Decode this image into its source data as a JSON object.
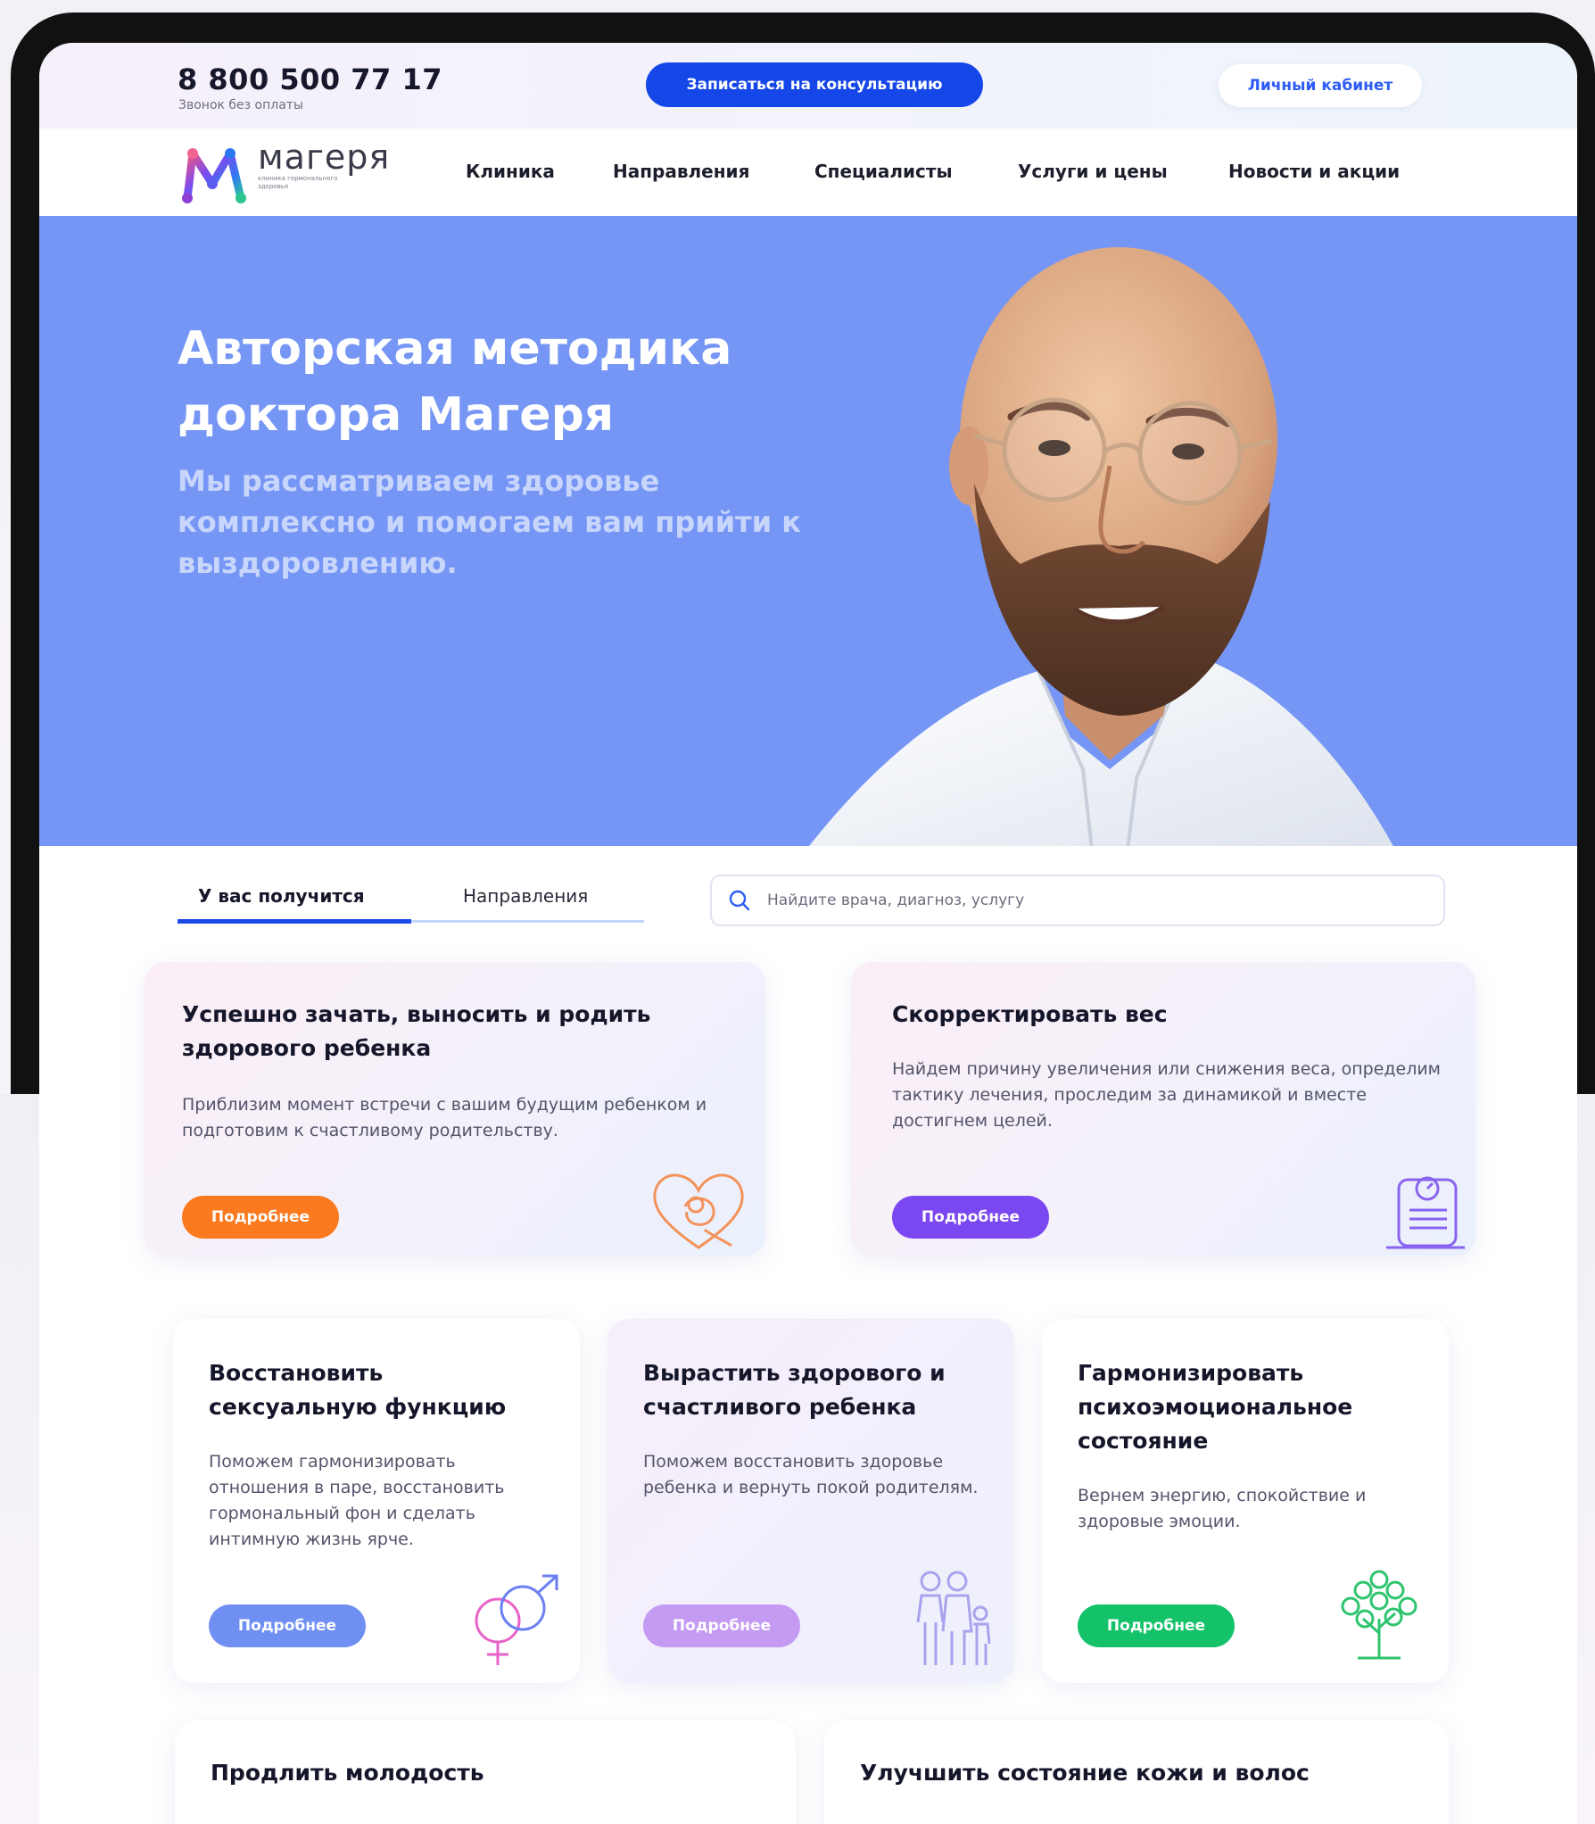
{
  "header": {
    "phone": "8 800 500 77 17",
    "phone_note": "Звонок без оплаты",
    "cta_label": "Записаться на консультацию",
    "cabinet_label": "Личный кабинет"
  },
  "logo": {
    "name": "магеря",
    "tagline": "клиника гормонального здоровья"
  },
  "nav": {
    "items": [
      "Клиника",
      "Направления",
      "Специалисты",
      "Услуги и цены",
      "Новости и акции"
    ]
  },
  "hero": {
    "title_line1": "Авторская методика",
    "title_line2": "доктора Магеря",
    "subtitle": "Мы рассматриваем здоровье комплексно и помогаем вам прийти к выздоровлению."
  },
  "tabs": {
    "active": "У вас получится",
    "inactive": "Направления"
  },
  "search": {
    "placeholder": "Найдите врача, диагноз, услугу"
  },
  "cards": [
    {
      "title": "Успешно зачать, выносить и родить здорового ребенка",
      "text": "Приблизим момент встречи с вашим будущим ребенком и подготовим к счастливому родительству.",
      "button": "Подробнее",
      "icon": "heart-baby-icon",
      "color": "#fb7a1f"
    },
    {
      "title": "Скорректировать вес",
      "text": "Найдем причину увеличения или снижения веса, определим тактику лечения, проследим за динамикой и вместе достигнем целей.",
      "button": "Подробнее",
      "icon": "scale-icon",
      "color": "#7b47f0"
    },
    {
      "title": "Восстановить сексуальную функцию",
      "text": "Поможем гармонизировать отношения в паре, восстановить гормональный фон и сделать интимную жизнь ярче.",
      "button": "Подробнее",
      "icon": "gender-symbols-icon",
      "color": "#6f8ff2"
    },
    {
      "title": "Вырастить здорового и счастливого ребенка",
      "text": "Поможем восстановить здоровье ребенка и вернуть покой родителям.",
      "button": "Подробнее",
      "icon": "family-icon",
      "color": "#c49af3"
    },
    {
      "title": "Гармонизировать психоэмоциональное состояние",
      "text": "Вернем энергию, спокойствие и здоровые эмоции.",
      "button": "Подробнее",
      "icon": "tree-icon",
      "color": "#14c26a"
    },
    {
      "title": "Продлить молодость",
      "icon": ""
    },
    {
      "title": "Улучшить состояние кожи и волос",
      "icon": ""
    }
  ],
  "colors": {
    "hero_bg": "#7696f5",
    "accent_blue": "#1546e8"
  }
}
